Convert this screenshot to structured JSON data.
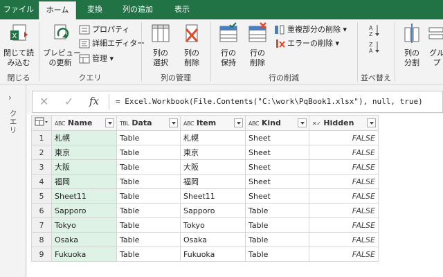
{
  "tabs": {
    "file": "ファイル",
    "home": "ホーム",
    "transform": "変換",
    "add_column": "列の追加",
    "view": "表示"
  },
  "ribbon": {
    "close": {
      "close_load": "閉じて読\nみ込む",
      "label": "閉じる"
    },
    "query": {
      "refresh_preview": "プレビュー\nの更新",
      "properties": "プロパティ",
      "advanced_editor": "詳細エディター",
      "manage": "管理",
      "label": "クエリ"
    },
    "manage_columns": {
      "choose": "列の\n選択",
      "remove": "列の\n削除",
      "label": "列の管理"
    },
    "reduce_rows": {
      "keep": "行の\n保持",
      "remove": "行の\n削除",
      "remove_duplicates": "重複部分の削除",
      "remove_errors": "エラーの削除",
      "label": "行の削減"
    },
    "sort": {
      "label": "並べ替え"
    },
    "split": {
      "split_column": "列の\n分割",
      "group_by": "グル\nプ"
    }
  },
  "sidepane": {
    "label": "クエリ"
  },
  "formula": {
    "fx": "fx",
    "text": "= Excel.Workbook(File.Contents(\"C:\\work\\PqBook1.xlsx\"), null, true)"
  },
  "grid": {
    "columns": [
      {
        "type": "ABC",
        "name": "Name"
      },
      {
        "type": "TBL",
        "name": "Data"
      },
      {
        "type": "ABC",
        "name": "Item"
      },
      {
        "type": "ABC",
        "name": "Kind"
      },
      {
        "type": "✕✓",
        "name": "Hidden"
      }
    ],
    "rows": [
      [
        "1",
        "札幌",
        "Table",
        "札幌",
        "Sheet",
        "FALSE"
      ],
      [
        "2",
        "東京",
        "Table",
        "東京",
        "Sheet",
        "FALSE"
      ],
      [
        "3",
        "大阪",
        "Table",
        "大阪",
        "Sheet",
        "FALSE"
      ],
      [
        "4",
        "福岡",
        "Table",
        "福岡",
        "Sheet",
        "FALSE"
      ],
      [
        "5",
        "Sheet11",
        "Table",
        "Sheet11",
        "Sheet",
        "FALSE"
      ],
      [
        "6",
        "Sapporo",
        "Table",
        "Sapporo",
        "Table",
        "FALSE"
      ],
      [
        "7",
        "Tokyo",
        "Table",
        "Tokyo",
        "Table",
        "FALSE"
      ],
      [
        "8",
        "Osaka",
        "Table",
        "Osaka",
        "Table",
        "FALSE"
      ],
      [
        "9",
        "Fukuoka",
        "Table",
        "Fukuoka",
        "Table",
        "FALSE"
      ]
    ]
  },
  "colors": {
    "accent": "#217346",
    "selected_column": "#dff2e6"
  }
}
